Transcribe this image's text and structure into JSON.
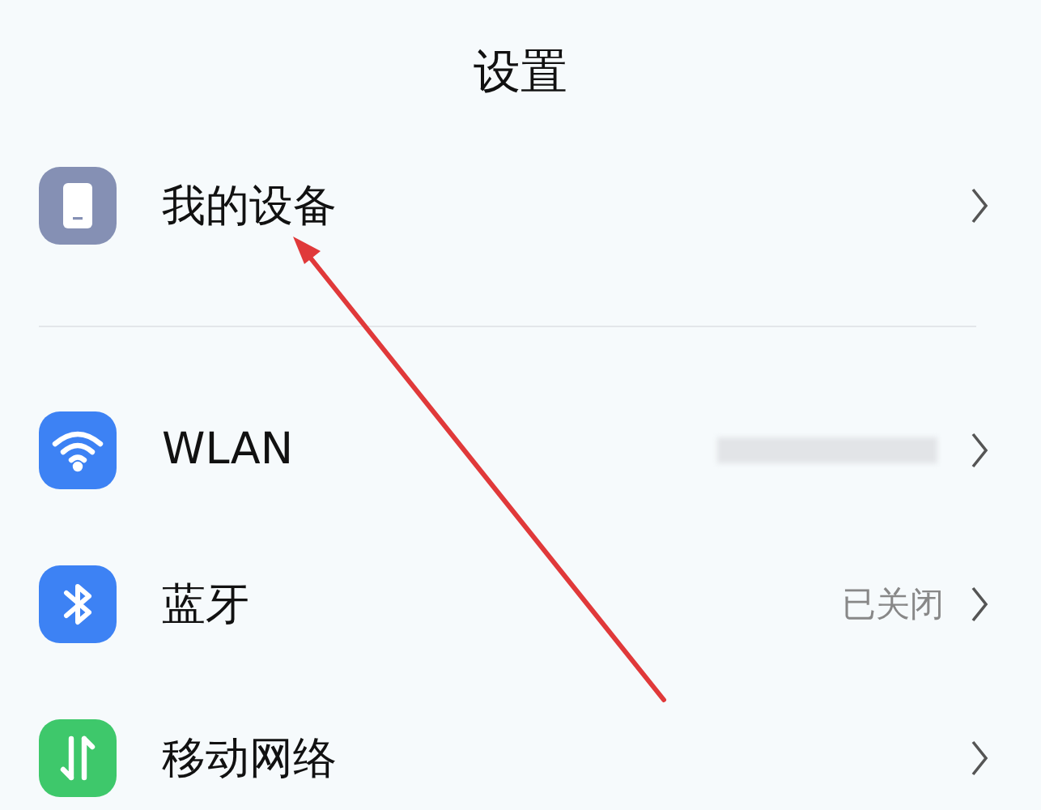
{
  "title": "设置",
  "groups": [
    {
      "items": [
        {
          "label": "我的设备",
          "kind": "device",
          "color": "#8590b4"
        }
      ]
    },
    {
      "items": [
        {
          "label": "WLAN",
          "kind": "wifi",
          "color": "#3d82f4",
          "redacted": true
        },
        {
          "label": "蓝牙",
          "kind": "bluetooth",
          "color": "#3d82f4",
          "value": "已关闭"
        },
        {
          "label": "移动网络",
          "kind": "mobile",
          "color": "#3ec86b"
        }
      ]
    }
  ],
  "annotation": {
    "kind": "arrow"
  }
}
